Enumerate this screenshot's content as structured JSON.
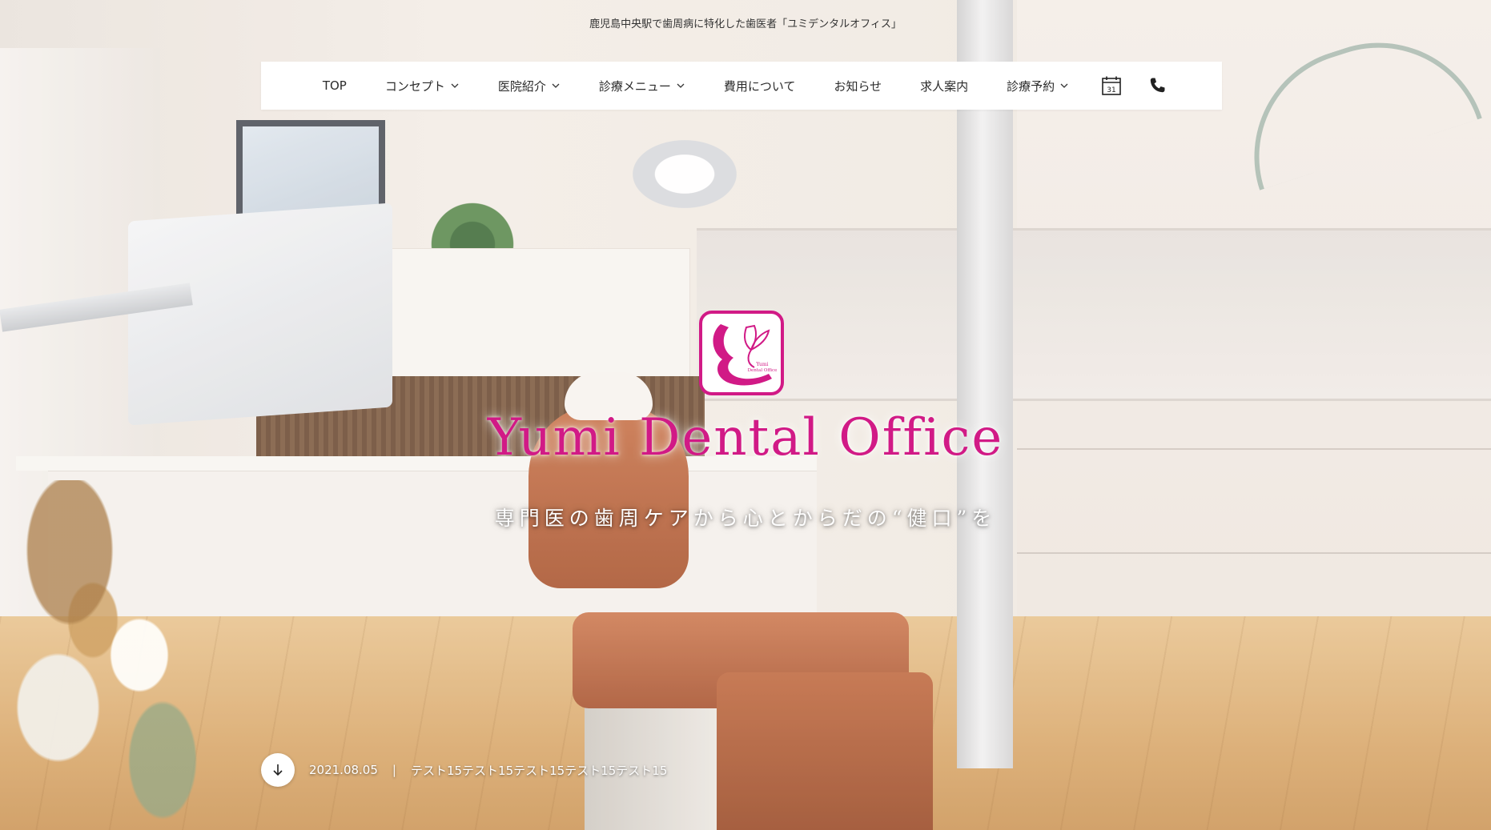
{
  "header": {
    "tagline": "鹿児島中央駅で歯周病に特化した歯医者「ユミデンタルオフィス」"
  },
  "nav": {
    "items": [
      {
        "label": "TOP",
        "has_dropdown": false
      },
      {
        "label": "コンセプト",
        "has_dropdown": true
      },
      {
        "label": "医院紹介",
        "has_dropdown": true
      },
      {
        "label": "診療メニュー",
        "has_dropdown": true
      },
      {
        "label": "費用について",
        "has_dropdown": false
      },
      {
        "label": "お知らせ",
        "has_dropdown": false
      },
      {
        "label": "求人案内",
        "has_dropdown": false
      },
      {
        "label": "診療予約",
        "has_dropdown": true
      }
    ],
    "calendar_icon": "calendar-icon",
    "calendar_day": "31",
    "phone_icon": "phone-icon"
  },
  "hero": {
    "logo_text_line1": "Yumi",
    "logo_text_line2": "Dental Office",
    "brand_name": "Yumi Dental Office",
    "subtitle": "専門医の歯周ケアから心とからだの“健口”を",
    "brand_color": "#d11a86"
  },
  "news": {
    "scroll_icon": "arrow-down-icon",
    "date": "2021.08.05",
    "separator": "|",
    "title": "テスト15テスト15テスト15テスト15テスト15"
  }
}
